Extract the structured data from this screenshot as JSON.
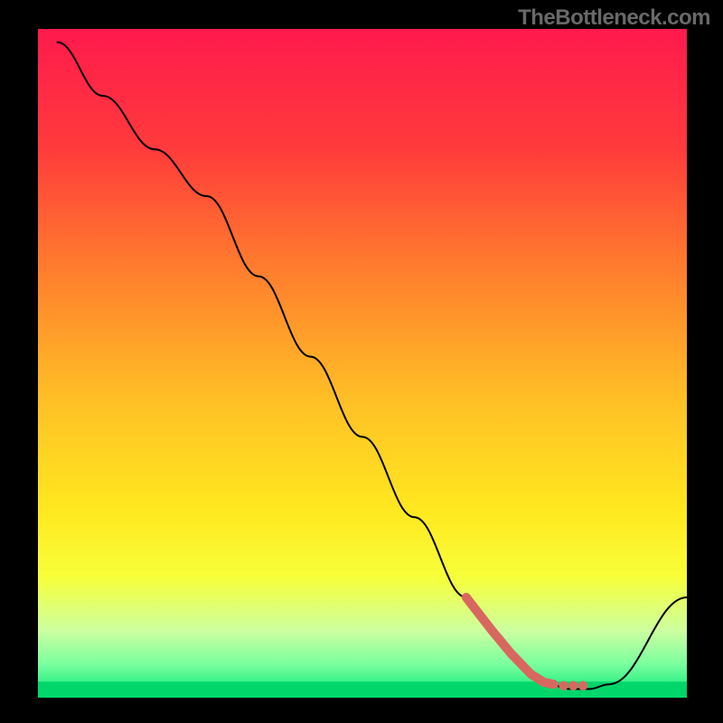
{
  "watermark": "TheBottleneck.com",
  "chart_data": {
    "type": "line",
    "title": "",
    "xlabel": "",
    "ylabel": "",
    "xlim": [
      0,
      100
    ],
    "ylim": [
      0,
      100
    ],
    "background": {
      "type": "vertical-gradient",
      "stops": [
        {
          "offset": 0.0,
          "color": "#ff1a4d"
        },
        {
          "offset": 0.18,
          "color": "#ff3b3b"
        },
        {
          "offset": 0.35,
          "color": "#ff7a2e"
        },
        {
          "offset": 0.55,
          "color": "#ffbe26"
        },
        {
          "offset": 0.72,
          "color": "#ffe81f"
        },
        {
          "offset": 0.82,
          "color": "#f7ff3a"
        },
        {
          "offset": 0.9,
          "color": "#ccffa0"
        },
        {
          "offset": 0.95,
          "color": "#7aff9e"
        },
        {
          "offset": 1.0,
          "color": "#00e676"
        }
      ]
    },
    "green_strip": {
      "color": "#00d66a",
      "thickness_pct": 2.4
    },
    "series": [
      {
        "name": "bottleneck-curve",
        "color": "#000000",
        "stroke_width": 2,
        "x": [
          3,
          10,
          18,
          26,
          34,
          42,
          50,
          58,
          66,
          70,
          74,
          78,
          82,
          85,
          88,
          100
        ],
        "y": [
          98,
          90,
          82,
          75,
          63,
          51,
          39,
          27,
          15,
          10,
          5.5,
          2.3,
          1.3,
          1.3,
          2.0,
          15
        ]
      },
      {
        "name": "highlight-segment",
        "color": "#d8685f",
        "stroke_width": 10,
        "x": [
          66,
          70,
          73,
          76,
          78,
          79.5,
          81,
          82.5,
          84
        ],
        "y": [
          15,
          10,
          6.5,
          3.5,
          2.3,
          2.0,
          1.8,
          1.8,
          1.8
        ]
      }
    ]
  }
}
